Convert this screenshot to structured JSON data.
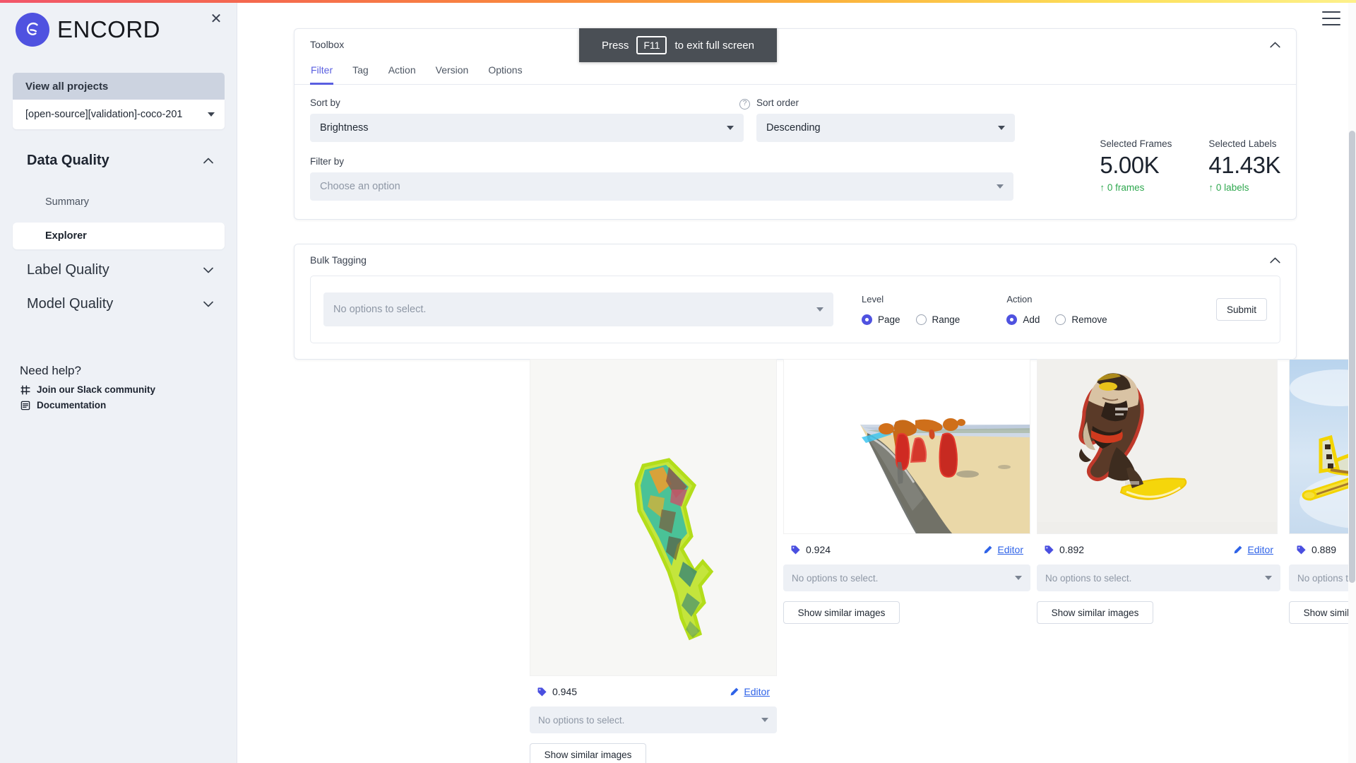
{
  "brand": {
    "name": "ENCORD",
    "logo_icon": "encord-logo-icon",
    "close_icon": "close-icon"
  },
  "sidebar": {
    "view_all_projects": "View all projects",
    "project": "[open-source][validation]-coco-201",
    "groups": [
      {
        "label": "Data Quality",
        "expanded": true,
        "chevron": "chevron-up-icon"
      },
      {
        "label": "Label Quality",
        "expanded": false,
        "chevron": "chevron-down-icon"
      },
      {
        "label": "Model Quality",
        "expanded": false,
        "chevron": "chevron-down-icon"
      }
    ],
    "data_quality_items": [
      {
        "label": "Summary",
        "active": false
      },
      {
        "label": "Explorer",
        "active": true
      }
    ],
    "help": {
      "title": "Need help?",
      "links": [
        {
          "label": "Join our Slack community",
          "icon": "slack-icon"
        },
        {
          "label": "Documentation",
          "icon": "book-icon"
        }
      ]
    }
  },
  "fullscreen_hint": {
    "prefix": "Press",
    "key": "F11",
    "suffix": "to exit full screen"
  },
  "header": {
    "menu_icon": "hamburger-menu-icon"
  },
  "toolbox": {
    "title": "Toolbox",
    "collapse_icon": "chevron-up-icon",
    "tabs": [
      {
        "label": "Filter",
        "active": true
      },
      {
        "label": "Tag",
        "active": false
      },
      {
        "label": "Action",
        "active": false
      },
      {
        "label": "Version",
        "active": false
      },
      {
        "label": "Options",
        "active": false
      }
    ],
    "sort_by": {
      "label": "Sort by",
      "value": "Brightness",
      "help_icon": "question-circle-icon"
    },
    "sort_order": {
      "label": "Sort order",
      "value": "Descending"
    },
    "filter_by": {
      "label": "Filter by",
      "placeholder": "Choose an option"
    },
    "stats": [
      {
        "caption": "Selected Frames",
        "value": "5.00K",
        "delta": "0 frames",
        "delta_icon": "arrow-up-icon",
        "delta_color": "#2fa84f"
      },
      {
        "caption": "Selected Labels",
        "value": "41.43K",
        "delta": "0 labels",
        "delta_icon": "arrow-up-icon",
        "delta_color": "#2fa84f"
      }
    ]
  },
  "bulk_tagging": {
    "title": "Bulk Tagging",
    "collapse_icon": "chevron-up-icon",
    "select_placeholder": "No options to select.",
    "level": {
      "label": "Level",
      "options": [
        {
          "label": "Page",
          "selected": true
        },
        {
          "label": "Range",
          "selected": false
        }
      ]
    },
    "action": {
      "label": "Action",
      "options": [
        {
          "label": "Add",
          "selected": true
        },
        {
          "label": "Remove",
          "selected": false
        }
      ]
    },
    "submit_label": "Submit"
  },
  "grid": {
    "select_placeholder": "No options to select.",
    "editor_label": "Editor",
    "editor_icon": "pencil-icon",
    "score_icon": "tag-icon",
    "similar_label": "Show similar images",
    "cards": [
      {
        "score": "0.945",
        "image": "kite-on-white-background",
        "tall": true
      },
      {
        "score": "0.924",
        "image": "people-in-red-robes-on-desert-shoreline",
        "tall": false
      },
      {
        "score": "0.892",
        "image": "snowboarder-on-white-background",
        "tall": false
      },
      {
        "score": "0.889",
        "image": "yellow-outlined-airplane-g-awgn-in-sky",
        "tall": false
      }
    ]
  },
  "colors": {
    "accent": "#4f52e0",
    "tab_active": "#5a5fe0",
    "link": "#2f63e8",
    "positive": "#2fa84f",
    "sidebar_bg": "#eef1f6",
    "field_bg": "#edf0f5"
  }
}
